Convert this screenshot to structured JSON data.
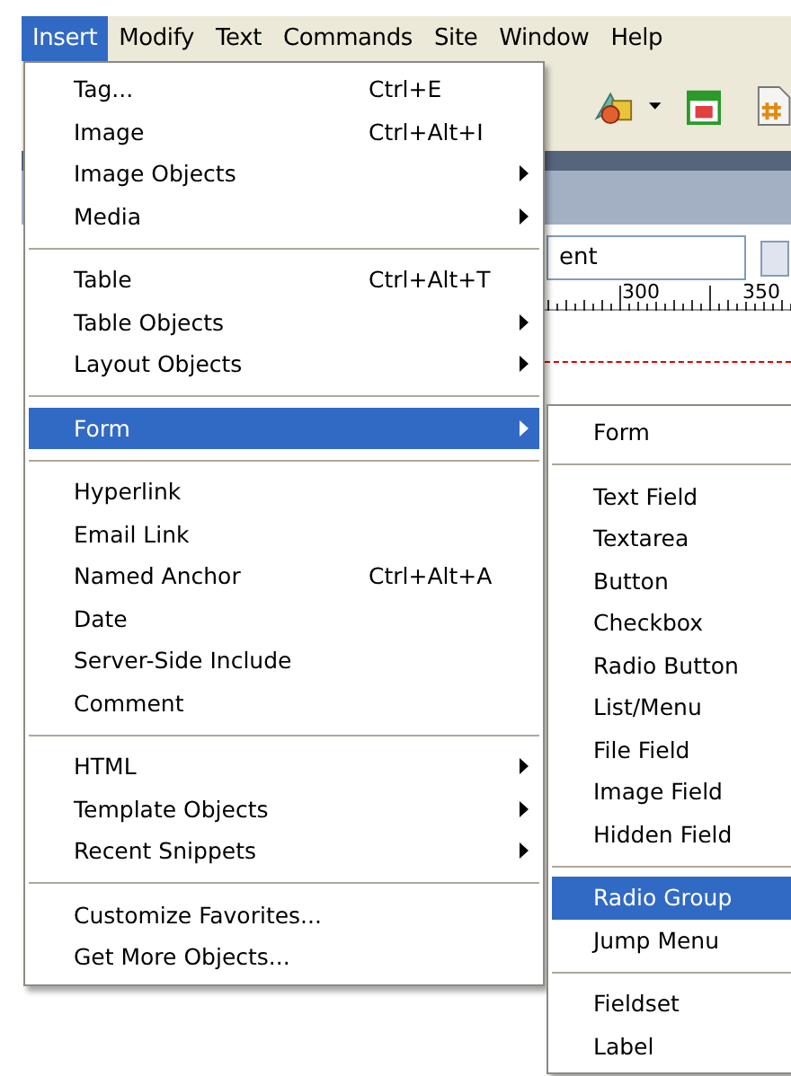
{
  "menu_bar": [
    {
      "label": "Insert",
      "selected": true
    },
    {
      "label": "Modify",
      "selected": false
    },
    {
      "label": "Text",
      "selected": false
    },
    {
      "label": "Commands",
      "selected": false
    },
    {
      "label": "Site",
      "selected": false
    },
    {
      "label": "Window",
      "selected": false
    },
    {
      "label": "Help",
      "selected": false
    }
  ],
  "document": {
    "field_value": "ent",
    "ruler_labels": [
      "300",
      "350"
    ]
  },
  "insert_menu": [
    [
      {
        "label": "Tag...",
        "shortcut": "Ctrl+E",
        "submenu": false,
        "selected": false
      },
      {
        "label": "Image",
        "shortcut": "Ctrl+Alt+I",
        "submenu": false,
        "selected": false
      },
      {
        "label": "Image Objects",
        "submenu": true,
        "selected": false
      },
      {
        "label": "Media",
        "submenu": true,
        "selected": false
      }
    ],
    [
      {
        "label": "Table",
        "shortcut": "Ctrl+Alt+T",
        "submenu": false,
        "selected": false
      },
      {
        "label": "Table Objects",
        "submenu": true,
        "selected": false
      },
      {
        "label": "Layout Objects",
        "submenu": true,
        "selected": false
      }
    ],
    [
      {
        "label": "Form",
        "submenu": true,
        "selected": true
      }
    ],
    [
      {
        "label": "Hyperlink",
        "submenu": false,
        "selected": false
      },
      {
        "label": "Email Link",
        "submenu": false,
        "selected": false
      },
      {
        "label": "Named Anchor",
        "shortcut": "Ctrl+Alt+A",
        "submenu": false,
        "selected": false
      },
      {
        "label": "Date",
        "submenu": false,
        "selected": false
      },
      {
        "label": "Server-Side Include",
        "submenu": false,
        "selected": false
      },
      {
        "label": "Comment",
        "submenu": false,
        "selected": false
      }
    ],
    [
      {
        "label": "HTML",
        "submenu": true,
        "selected": false
      },
      {
        "label": "Template Objects",
        "submenu": true,
        "selected": false
      },
      {
        "label": "Recent Snippets",
        "submenu": true,
        "selected": false
      }
    ],
    [
      {
        "label": "Customize Favorites...",
        "submenu": false,
        "selected": false
      },
      {
        "label": "Get More Objects...",
        "submenu": false,
        "selected": false
      }
    ]
  ],
  "form_submenu": [
    [
      {
        "label": "Form",
        "selected": false
      }
    ],
    [
      {
        "label": "Text Field",
        "selected": false
      },
      {
        "label": "Textarea",
        "selected": false
      },
      {
        "label": "Button",
        "selected": false
      },
      {
        "label": "Checkbox",
        "selected": false
      },
      {
        "label": "Radio Button",
        "selected": false
      },
      {
        "label": "List/Menu",
        "selected": false
      },
      {
        "label": "File Field",
        "selected": false
      },
      {
        "label": "Image Field",
        "selected": false
      },
      {
        "label": "Hidden Field",
        "selected": false
      }
    ],
    [
      {
        "label": "Radio Group",
        "selected": true
      },
      {
        "label": "Jump Menu",
        "selected": false
      }
    ],
    [
      {
        "label": "Fieldset",
        "selected": false
      },
      {
        "label": "Label",
        "selected": false
      }
    ]
  ]
}
